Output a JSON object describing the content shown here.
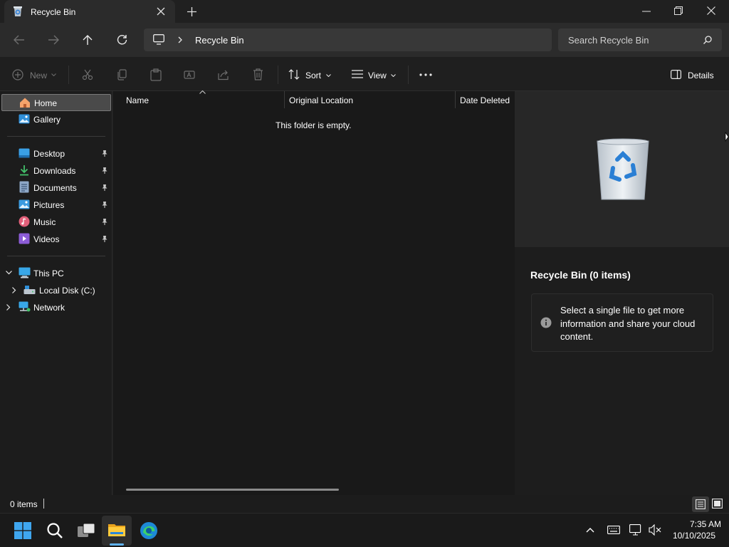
{
  "window": {
    "tab_title": "Recycle Bin"
  },
  "address": {
    "location": "Recycle Bin",
    "search_placeholder": "Search Recycle Bin"
  },
  "toolbar": {
    "new_label": "New",
    "sort_label": "Sort",
    "view_label": "View",
    "details_label": "Details"
  },
  "sidebar": {
    "items": [
      {
        "label": "Home"
      },
      {
        "label": "Gallery"
      },
      {
        "label": "Desktop"
      },
      {
        "label": "Downloads"
      },
      {
        "label": "Documents"
      },
      {
        "label": "Pictures"
      },
      {
        "label": "Music"
      },
      {
        "label": "Videos"
      },
      {
        "label": "This PC"
      },
      {
        "label": "Local Disk (C:)"
      },
      {
        "label": "Network"
      }
    ]
  },
  "filelist": {
    "columns": [
      "Name",
      "Original Location",
      "Date Deleted"
    ],
    "empty_message": "This folder is empty."
  },
  "details_pane": {
    "title": "Recycle Bin (0 items)",
    "info": "Select a single file to get more information and share your cloud content."
  },
  "statusbar": {
    "count": "0 items"
  },
  "taskbar": {
    "time": "7:35 AM",
    "date": "10/10/2025"
  }
}
